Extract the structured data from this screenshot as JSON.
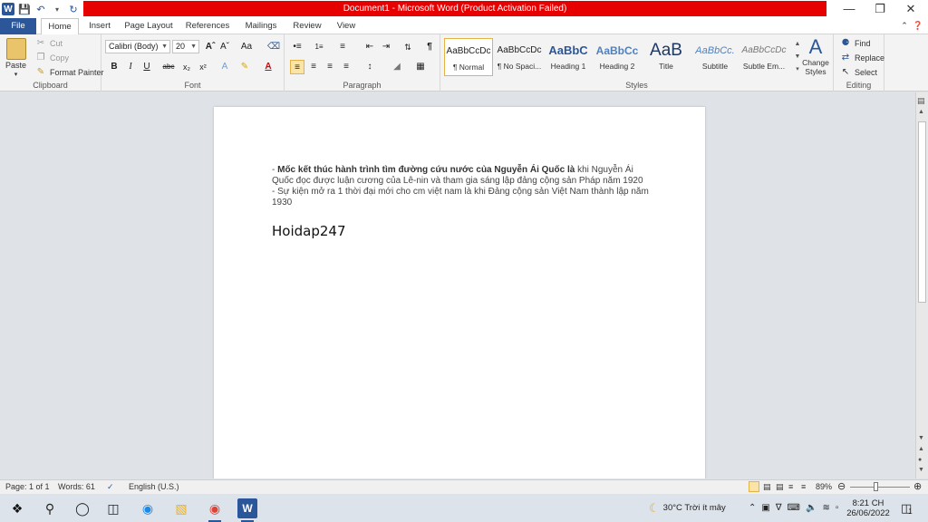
{
  "window": {
    "title": "Document1 - Microsoft Word (Product Activation Failed)",
    "title_bar_color": "#e60000"
  },
  "qat": {
    "icons": [
      "word-icon",
      "save-icon",
      "undo-icon",
      "redo-icon",
      "customize-icon"
    ],
    "word_letter": "W"
  },
  "tabs": [
    "File",
    "Home",
    "Insert",
    "Page Layout",
    "References",
    "Mailings",
    "Review",
    "View"
  ],
  "clipboard": {
    "paste": "Paste",
    "cut": "Cut",
    "copy": "Copy",
    "format_painter": "Format Painter",
    "label": "Clipboard"
  },
  "font": {
    "family": "Calibri (Body)",
    "size": "20",
    "label": "Font"
  },
  "paragraph": {
    "label": "Paragraph"
  },
  "styles": {
    "label": "Styles",
    "items": [
      {
        "sample": "AaBbCcDc",
        "name": "¶ Normal"
      },
      {
        "sample": "AaBbCcDc",
        "name": "¶ No Spaci..."
      },
      {
        "sample": "AaBbC",
        "name": "Heading 1"
      },
      {
        "sample": "AaBbCc",
        "name": "Heading 2"
      },
      {
        "sample": "AaB",
        "name": "Title"
      },
      {
        "sample": "AaBbCc.",
        "name": "Subtitle"
      },
      {
        "sample": "AaBbCcDc",
        "name": "Subtle Em..."
      }
    ],
    "change_styles": "Change Styles"
  },
  "editing": {
    "find": "Find",
    "replace": "Replace",
    "select": "Select",
    "label": "Editing"
  },
  "document": {
    "line1_dash": "- ",
    "line1_bold": "Mốc kết thúc hành trình tìm đường cứu nước của Nguyễn Ái Quốc là",
    "line1_rest": " khi Nguyễn Ái Quốc đọc được luận cương của Lê-nin và tham gia sáng lập đảng cộng sản Pháp năm 1920",
    "line2": "- Sự kiện mở ra 1 thời đại mới cho cm việt nam là khi Đảng cộng sản Việt Nam thành lập năm 1930",
    "line3": "Hoidap247"
  },
  "status": {
    "page": "Page: 1 of 1",
    "words": "Words: 61",
    "language": "English (U.S.)",
    "zoom": "89%"
  },
  "taskbar": {
    "weather": "30°C  Trời ít mây",
    "time": "8:21 CH",
    "date": "26/06/2022",
    "notifications": "1"
  }
}
